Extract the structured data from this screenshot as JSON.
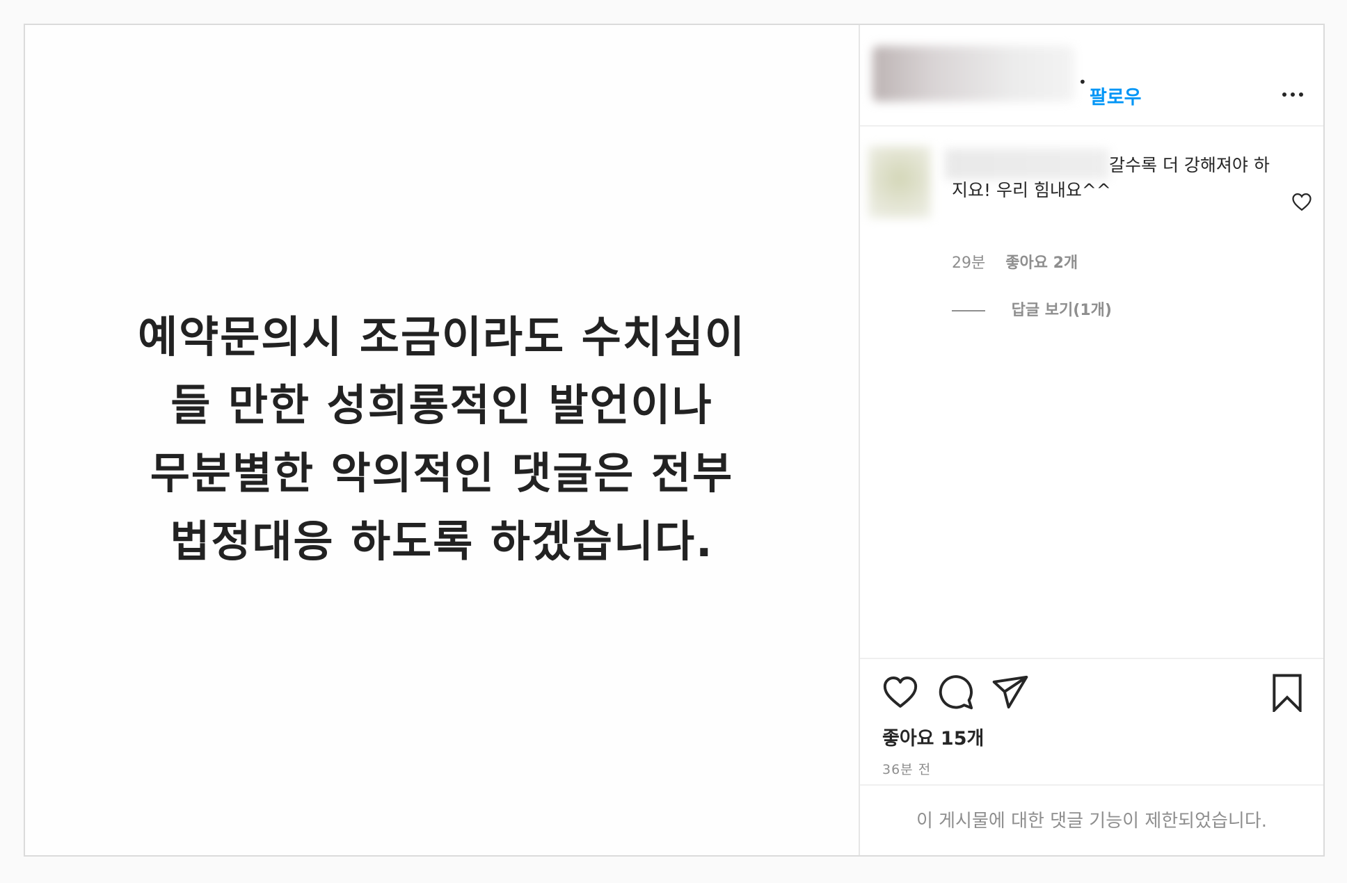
{
  "post": {
    "image_text_lines": [
      "예약문의시 조금이라도 수치심이",
      "들 만한 성희롱적인 발언이나",
      "무분별한 악의적인 댓글은 전부",
      "법정대응 하도록 하겠습니다."
    ]
  },
  "header": {
    "separator": "•",
    "follow_label": "팔로우",
    "more_icon": "more-horizontal-icon"
  },
  "comment": {
    "text": "갈수록 더 강해져야 하지요! 우리 힘내요^^",
    "time": "29분",
    "likes": "좋아요 2개",
    "view_replies": "답글 보기(1개)",
    "heart_icon": "heart-outline-icon"
  },
  "actions": {
    "icons": [
      "heart-icon",
      "comment-icon",
      "share-icon",
      "bookmark-icon"
    ],
    "likes_count": "좋아요 15개",
    "time_ago": "36분 전"
  },
  "restricted_notice": "이 게시물에 대한 댓글 기능이 제한되었습니다.",
  "colors": {
    "accent": "#0095f6",
    "muted": "#8e8e8e",
    "text": "#262626",
    "border": "#dbdbdb"
  }
}
